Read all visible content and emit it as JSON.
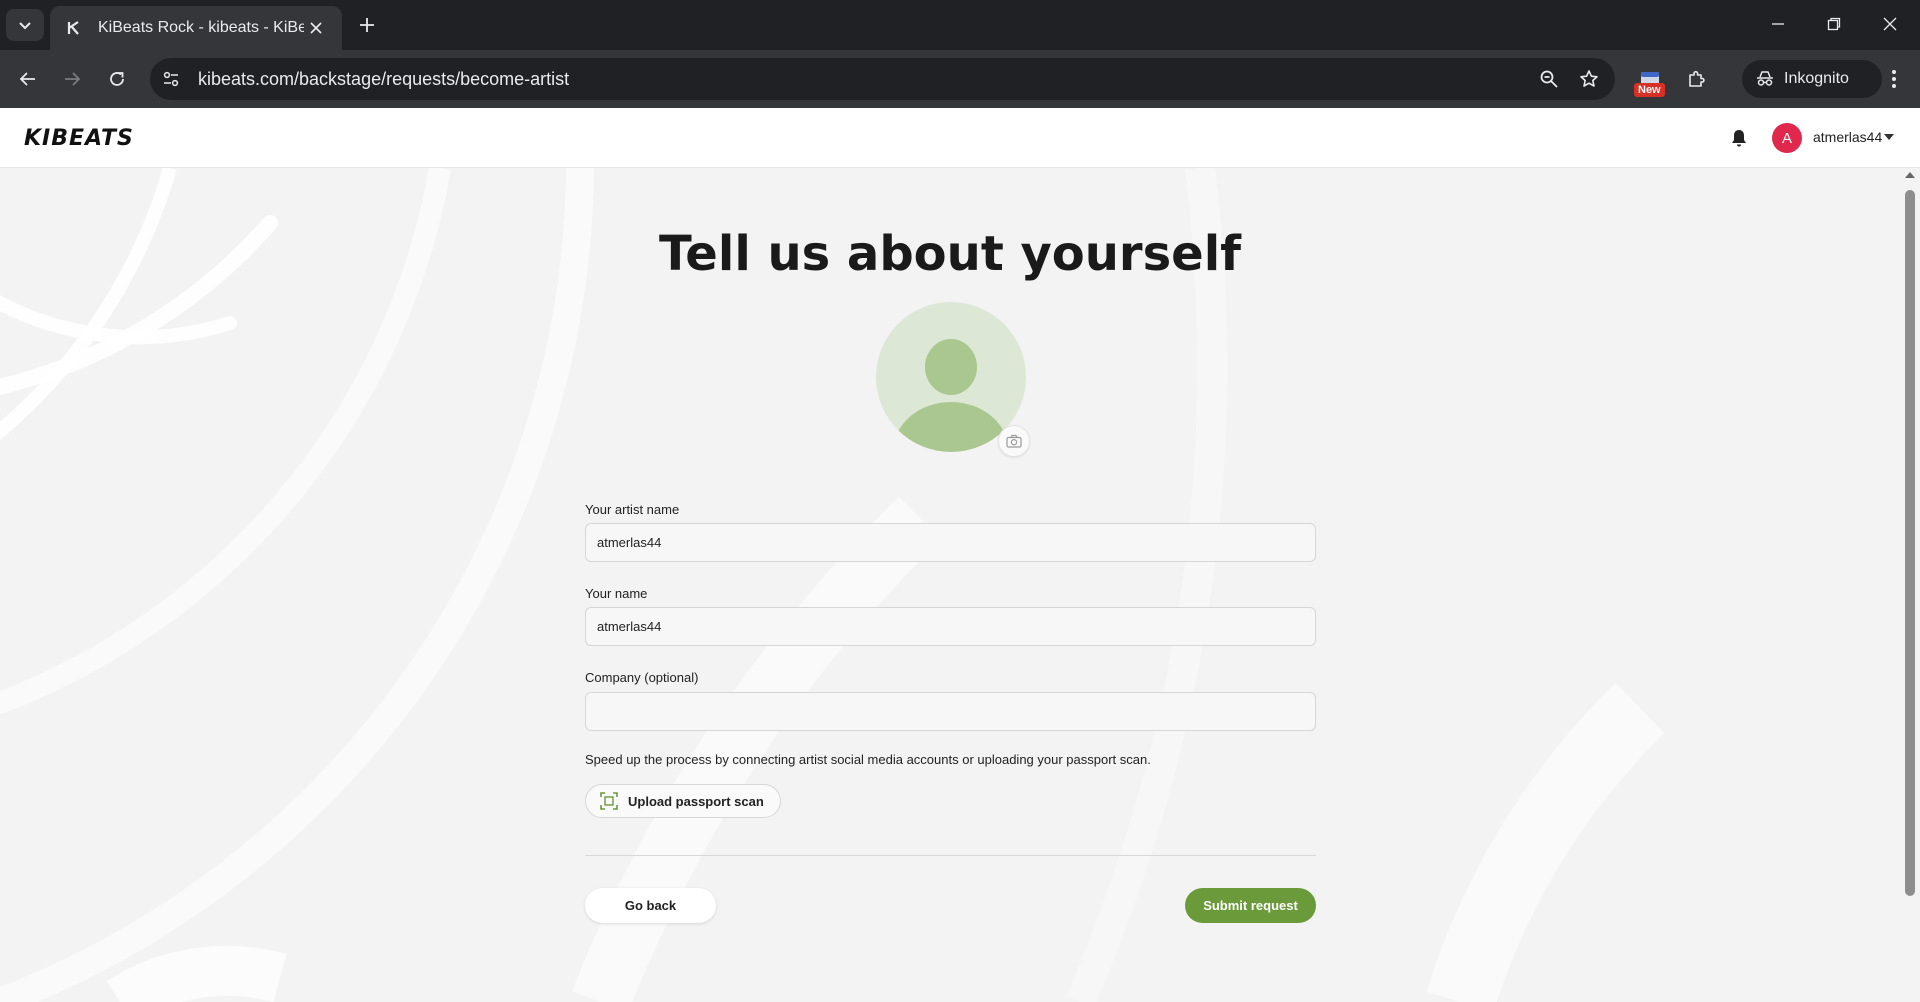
{
  "browser": {
    "tab_title": "KiBeats Rock - kibeats - KiBeats",
    "url": "kibeats.com/backstage/requests/become-artist",
    "extension_badge": "New",
    "profile_label": "Inkognito"
  },
  "app": {
    "logo": "KIBEATS",
    "user": {
      "avatar_letter": "A",
      "username": "atmerlas44"
    }
  },
  "form": {
    "title": "Tell us about yourself",
    "artist_name": {
      "label": "Your artist name",
      "value": "atmerlas44"
    },
    "your_name": {
      "label": "Your name",
      "value": "atmerlas44"
    },
    "company": {
      "label": "Company (optional)",
      "value": ""
    },
    "helper_text": "Speed up the process by connecting artist social media accounts or uploading your passport scan.",
    "upload_label": "Upload passport scan",
    "back_label": "Go back",
    "submit_label": "Submit request"
  },
  "colors": {
    "accent": "#6a9a3a",
    "avatar": "#e0274c",
    "placeholder_bg": "#dce7d5",
    "placeholder_fg": "#a9c78f"
  },
  "icons": {
    "tab_search": "chevron-down-icon",
    "favicon": "kibeats-favicon",
    "zoom": "zoom-icon",
    "bookmark": "star-icon",
    "extensions": "puzzle-icon",
    "incognito": "incognito-icon",
    "notifications": "bell-icon",
    "camera": "camera-icon",
    "upload": "scan-icon"
  }
}
